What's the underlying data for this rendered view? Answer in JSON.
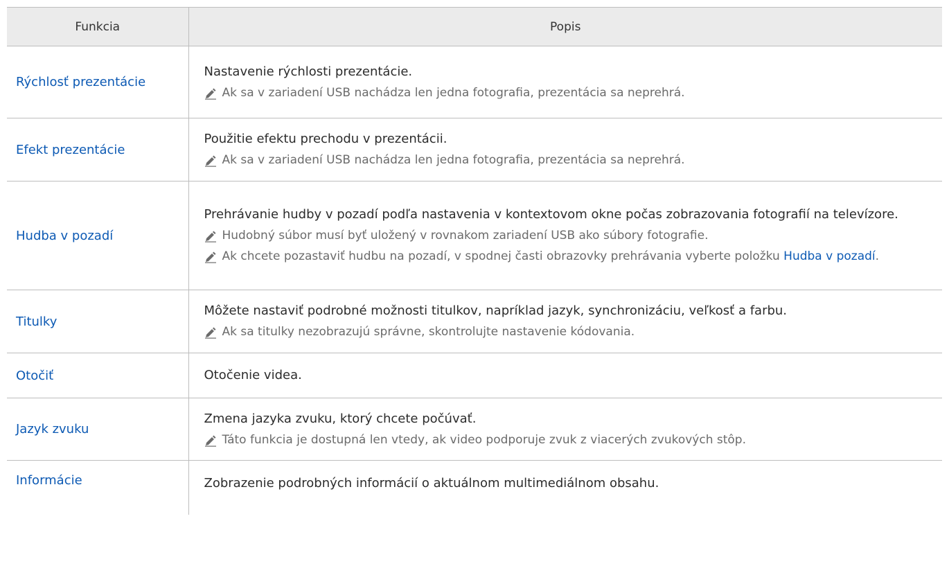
{
  "table": {
    "headers": {
      "feature": "Funkcia",
      "description": "Popis"
    },
    "rows": [
      {
        "feature": "Rýchlosť prezentácie",
        "description": "Nastavenie rýchlosti prezentácie.",
        "notes": [
          "Ak sa v zariadení USB nachádza len jedna fotografia, prezentácia sa neprehrá."
        ]
      },
      {
        "feature": "Efekt prezentácie",
        "description": "Použitie efektu prechodu v prezentácii.",
        "notes": [
          "Ak sa v zariadení USB nachádza len jedna fotografia, prezentácia sa neprehrá."
        ]
      },
      {
        "feature": "Hudba v pozadí",
        "description": "Prehrávanie hudby v pozadí podľa nastavenia v kontextovom okne počas zobrazovania fotografií na televízore.",
        "notes": [
          "Hudobný súbor musí byť uložený v rovnakom zariadení USB ako súbory fotografie.",
          "Ak chcete pozastaviť hudbu na pozadí, v spodnej časti obrazovky prehrávania vyberte položku "
        ],
        "note_link": "Hudba v pozadí",
        "note_suffix": "."
      },
      {
        "feature": "Titulky",
        "description": "Môžete nastaviť podrobné možnosti titulkov, napríklad jazyk, synchronizáciu, veľkosť a farbu.",
        "notes": [
          "Ak sa titulky nezobrazujú správne, skontrolujte nastavenie kódovania."
        ]
      },
      {
        "feature": "Otočiť",
        "description": "Otočenie videa."
      },
      {
        "feature": "Jazyk zvuku",
        "description": "Zmena jazyka zvuku, ktorý chcete počúvať.",
        "notes": [
          "Táto funkcia je dostupná len vtedy, ak video podporuje zvuk z viacerých zvukových stôp."
        ]
      },
      {
        "feature": "Informácie",
        "description": "Zobrazenie podrobných informácií o aktuálnom multimediálnom obsahu."
      }
    ]
  },
  "icons": {
    "note": "pencil-note-icon"
  },
  "colors": {
    "link": "#0d5ab4",
    "header_bg": "#ebebeb",
    "border": "#bdbdbd",
    "note_text": "#6b6b6b"
  }
}
